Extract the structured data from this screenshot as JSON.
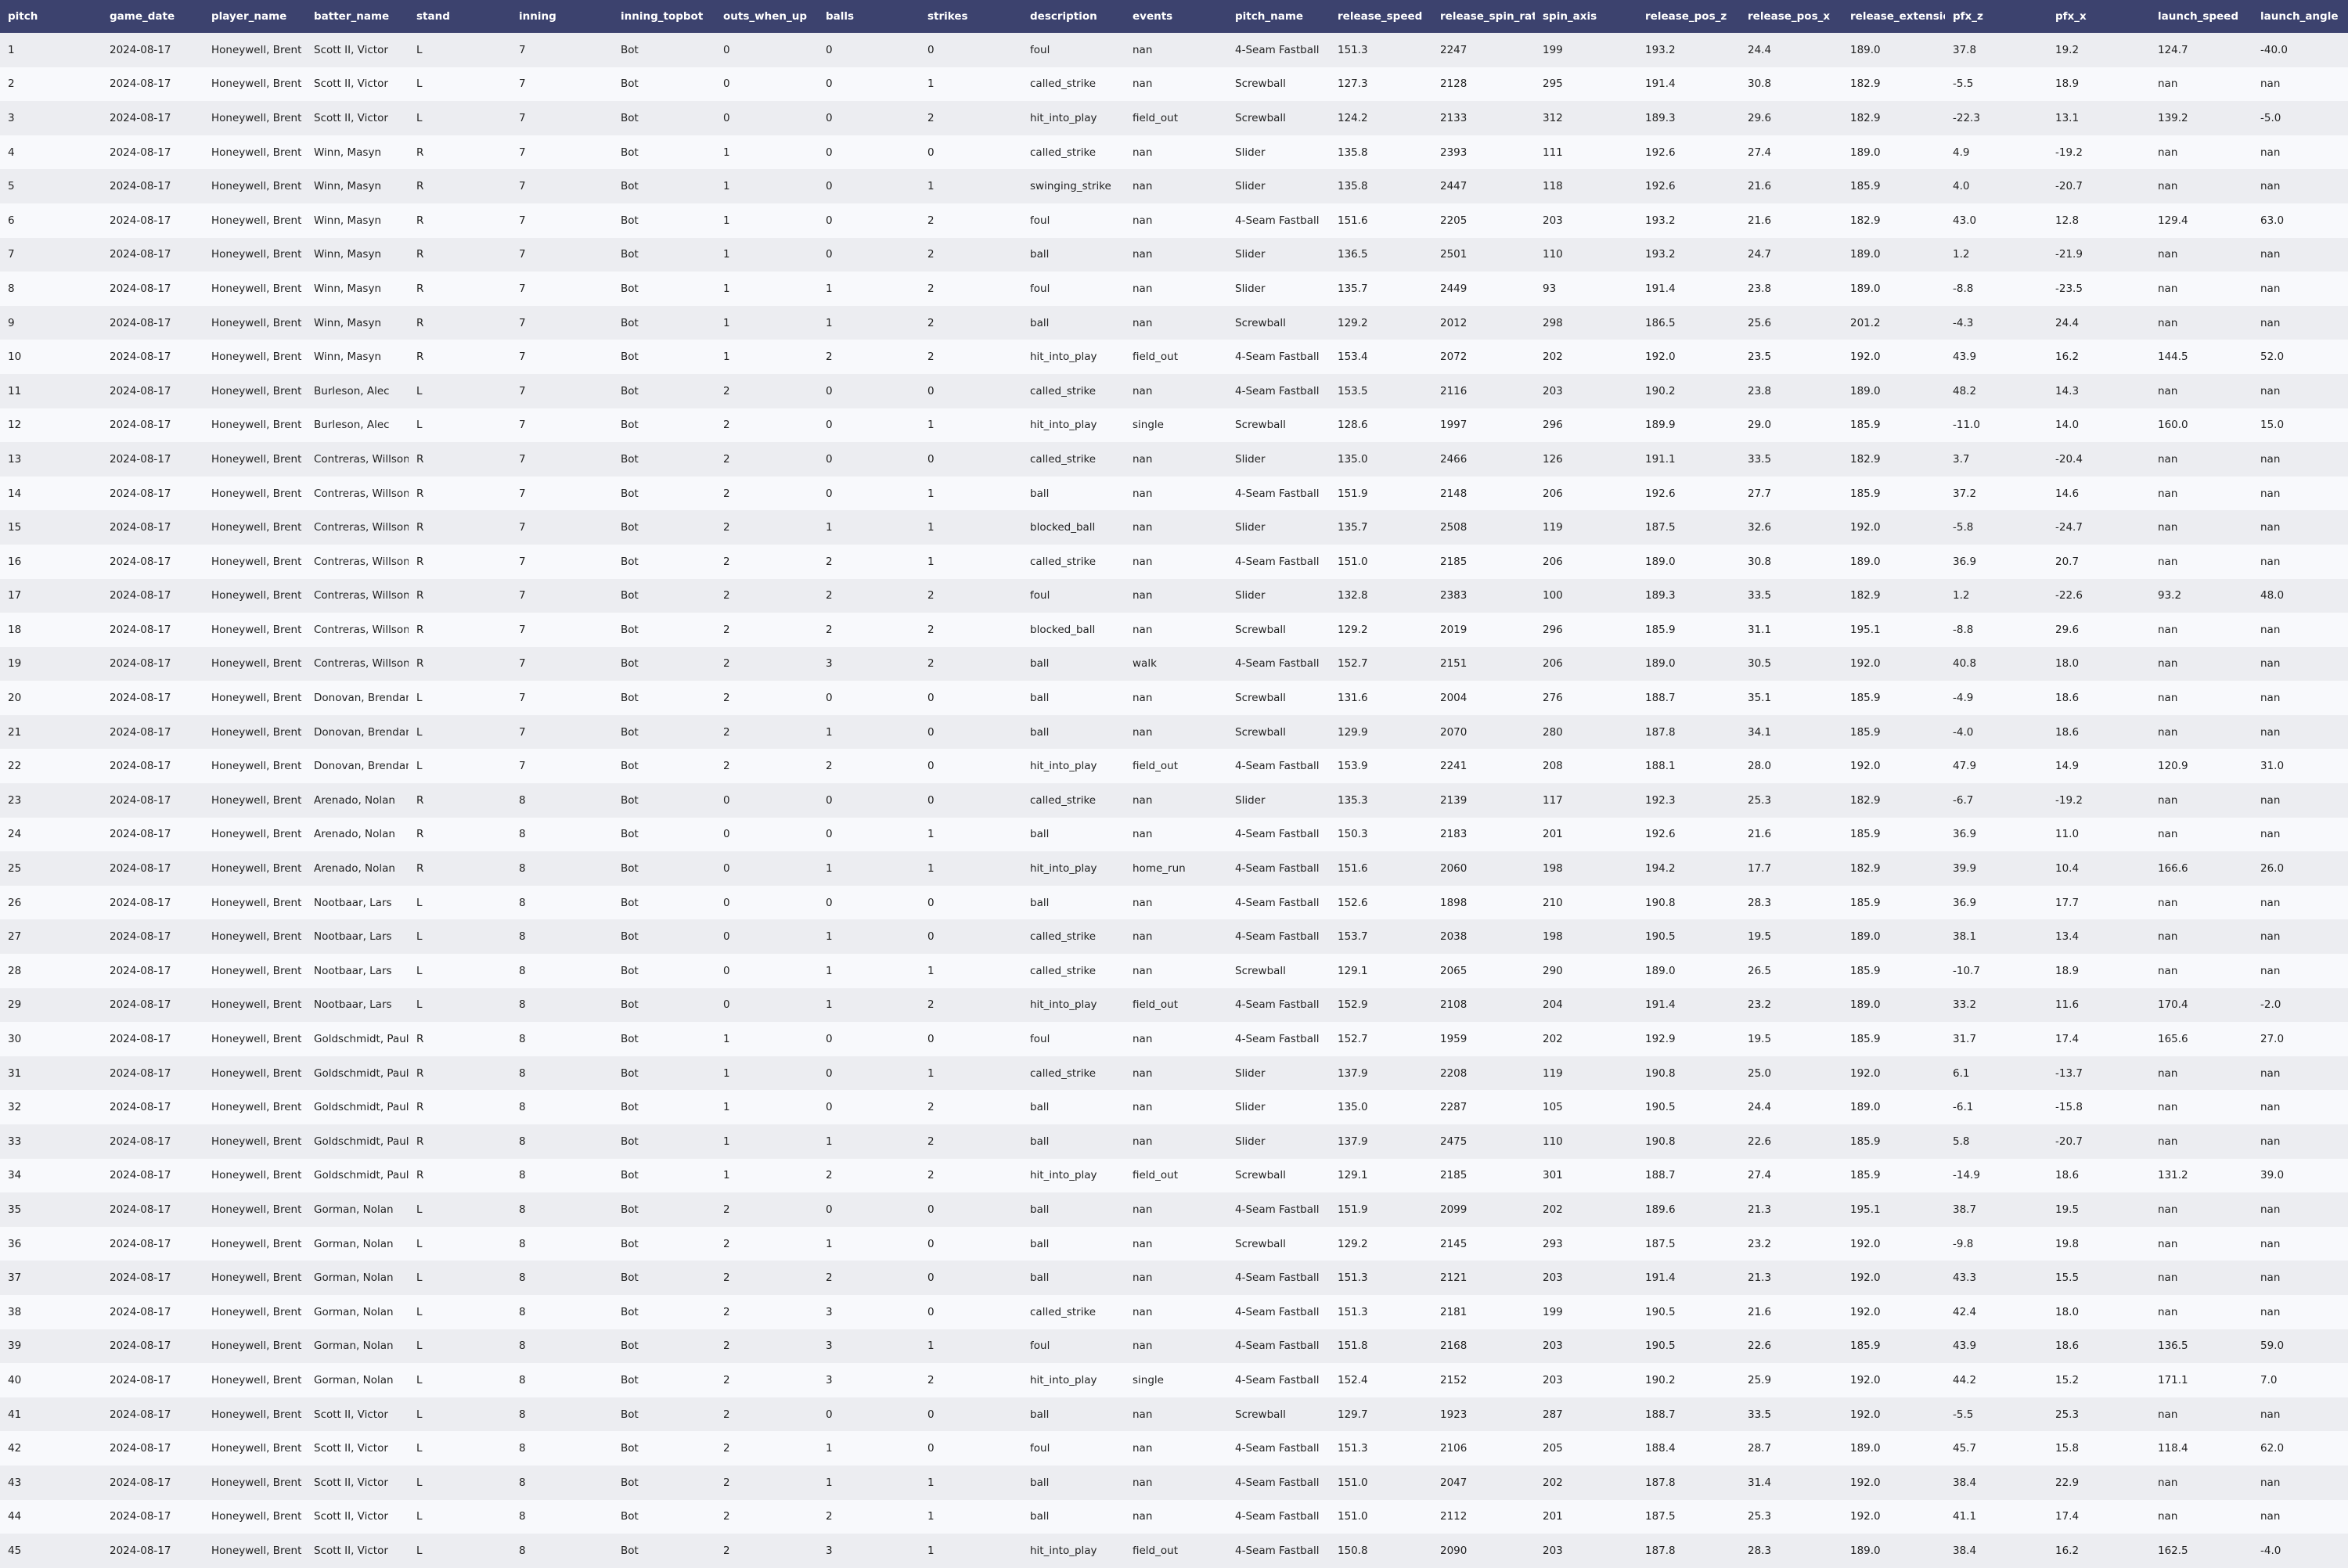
{
  "table": {
    "columns": [
      "pitch",
      "game_date",
      "player_name",
      "batter_name",
      "stand",
      "inning",
      "inning_topbot",
      "outs_when_up",
      "balls",
      "strikes",
      "description",
      "events",
      "pitch_name",
      "release_speed",
      "release_spin_rate",
      "spin_axis",
      "release_pos_z",
      "release_pos_x",
      "release_extension",
      "pfx_z",
      "pfx_x",
      "launch_speed",
      "launch_angle"
    ],
    "rows": [
      [
        "1",
        "2024-08-17",
        "Honeywell, Brent",
        "Scott II, Victor",
        "L",
        "7",
        "Bot",
        "0",
        "0",
        "0",
        "foul",
        "nan",
        "4-Seam Fastball",
        "151.3",
        "2247",
        "199",
        "193.2",
        "24.4",
        "189.0",
        "37.8",
        "19.2",
        "124.7",
        "-40.0"
      ],
      [
        "2",
        "2024-08-17",
        "Honeywell, Brent",
        "Scott II, Victor",
        "L",
        "7",
        "Bot",
        "0",
        "0",
        "1",
        "called_strike",
        "nan",
        "Screwball",
        "127.3",
        "2128",
        "295",
        "191.4",
        "30.8",
        "182.9",
        "-5.5",
        "18.9",
        "nan",
        "nan"
      ],
      [
        "3",
        "2024-08-17",
        "Honeywell, Brent",
        "Scott II, Victor",
        "L",
        "7",
        "Bot",
        "0",
        "0",
        "2",
        "hit_into_play",
        "field_out",
        "Screwball",
        "124.2",
        "2133",
        "312",
        "189.3",
        "29.6",
        "182.9",
        "-22.3",
        "13.1",
        "139.2",
        "-5.0"
      ],
      [
        "4",
        "2024-08-17",
        "Honeywell, Brent",
        "Winn, Masyn",
        "R",
        "7",
        "Bot",
        "1",
        "0",
        "0",
        "called_strike",
        "nan",
        "Slider",
        "135.8",
        "2393",
        "111",
        "192.6",
        "27.4",
        "189.0",
        "4.9",
        "-19.2",
        "nan",
        "nan"
      ],
      [
        "5",
        "2024-08-17",
        "Honeywell, Brent",
        "Winn, Masyn",
        "R",
        "7",
        "Bot",
        "1",
        "0",
        "1",
        "swinging_strike",
        "nan",
        "Slider",
        "135.8",
        "2447",
        "118",
        "192.6",
        "21.6",
        "185.9",
        "4.0",
        "-20.7",
        "nan",
        "nan"
      ],
      [
        "6",
        "2024-08-17",
        "Honeywell, Brent",
        "Winn, Masyn",
        "R",
        "7",
        "Bot",
        "1",
        "0",
        "2",
        "foul",
        "nan",
        "4-Seam Fastball",
        "151.6",
        "2205",
        "203",
        "193.2",
        "21.6",
        "182.9",
        "43.0",
        "12.8",
        "129.4",
        "63.0"
      ],
      [
        "7",
        "2024-08-17",
        "Honeywell, Brent",
        "Winn, Masyn",
        "R",
        "7",
        "Bot",
        "1",
        "0",
        "2",
        "ball",
        "nan",
        "Slider",
        "136.5",
        "2501",
        "110",
        "193.2",
        "24.7",
        "189.0",
        "1.2",
        "-21.9",
        "nan",
        "nan"
      ],
      [
        "8",
        "2024-08-17",
        "Honeywell, Brent",
        "Winn, Masyn",
        "R",
        "7",
        "Bot",
        "1",
        "1",
        "2",
        "foul",
        "nan",
        "Slider",
        "135.7",
        "2449",
        "93",
        "191.4",
        "23.8",
        "189.0",
        "-8.8",
        "-23.5",
        "nan",
        "nan"
      ],
      [
        "9",
        "2024-08-17",
        "Honeywell, Brent",
        "Winn, Masyn",
        "R",
        "7",
        "Bot",
        "1",
        "1",
        "2",
        "ball",
        "nan",
        "Screwball",
        "129.2",
        "2012",
        "298",
        "186.5",
        "25.6",
        "201.2",
        "-4.3",
        "24.4",
        "nan",
        "nan"
      ],
      [
        "10",
        "2024-08-17",
        "Honeywell, Brent",
        "Winn, Masyn",
        "R",
        "7",
        "Bot",
        "1",
        "2",
        "2",
        "hit_into_play",
        "field_out",
        "4-Seam Fastball",
        "153.4",
        "2072",
        "202",
        "192.0",
        "23.5",
        "192.0",
        "43.9",
        "16.2",
        "144.5",
        "52.0"
      ],
      [
        "11",
        "2024-08-17",
        "Honeywell, Brent",
        "Burleson, Alec",
        "L",
        "7",
        "Bot",
        "2",
        "0",
        "0",
        "called_strike",
        "nan",
        "4-Seam Fastball",
        "153.5",
        "2116",
        "203",
        "190.2",
        "23.8",
        "189.0",
        "48.2",
        "14.3",
        "nan",
        "nan"
      ],
      [
        "12",
        "2024-08-17",
        "Honeywell, Brent",
        "Burleson, Alec",
        "L",
        "7",
        "Bot",
        "2",
        "0",
        "1",
        "hit_into_play",
        "single",
        "Screwball",
        "128.6",
        "1997",
        "296",
        "189.9",
        "29.0",
        "185.9",
        "-11.0",
        "14.0",
        "160.0",
        "15.0"
      ],
      [
        "13",
        "2024-08-17",
        "Honeywell, Brent",
        "Contreras, Willson",
        "R",
        "7",
        "Bot",
        "2",
        "0",
        "0",
        "called_strike",
        "nan",
        "Slider",
        "135.0",
        "2466",
        "126",
        "191.1",
        "33.5",
        "182.9",
        "3.7",
        "-20.4",
        "nan",
        "nan"
      ],
      [
        "14",
        "2024-08-17",
        "Honeywell, Brent",
        "Contreras, Willson",
        "R",
        "7",
        "Bot",
        "2",
        "0",
        "1",
        "ball",
        "nan",
        "4-Seam Fastball",
        "151.9",
        "2148",
        "206",
        "192.6",
        "27.7",
        "185.9",
        "37.2",
        "14.6",
        "nan",
        "nan"
      ],
      [
        "15",
        "2024-08-17",
        "Honeywell, Brent",
        "Contreras, Willson",
        "R",
        "7",
        "Bot",
        "2",
        "1",
        "1",
        "blocked_ball",
        "nan",
        "Slider",
        "135.7",
        "2508",
        "119",
        "187.5",
        "32.6",
        "192.0",
        "-5.8",
        "-24.7",
        "nan",
        "nan"
      ],
      [
        "16",
        "2024-08-17",
        "Honeywell, Brent",
        "Contreras, Willson",
        "R",
        "7",
        "Bot",
        "2",
        "2",
        "1",
        "called_strike",
        "nan",
        "4-Seam Fastball",
        "151.0",
        "2185",
        "206",
        "189.0",
        "30.8",
        "189.0",
        "36.9",
        "20.7",
        "nan",
        "nan"
      ],
      [
        "17",
        "2024-08-17",
        "Honeywell, Brent",
        "Contreras, Willson",
        "R",
        "7",
        "Bot",
        "2",
        "2",
        "2",
        "foul",
        "nan",
        "Slider",
        "132.8",
        "2383",
        "100",
        "189.3",
        "33.5",
        "182.9",
        "1.2",
        "-22.6",
        "93.2",
        "48.0"
      ],
      [
        "18",
        "2024-08-17",
        "Honeywell, Brent",
        "Contreras, Willson",
        "R",
        "7",
        "Bot",
        "2",
        "2",
        "2",
        "blocked_ball",
        "nan",
        "Screwball",
        "129.2",
        "2019",
        "296",
        "185.9",
        "31.1",
        "195.1",
        "-8.8",
        "29.6",
        "nan",
        "nan"
      ],
      [
        "19",
        "2024-08-17",
        "Honeywell, Brent",
        "Contreras, Willson",
        "R",
        "7",
        "Bot",
        "2",
        "3",
        "2",
        "ball",
        "walk",
        "4-Seam Fastball",
        "152.7",
        "2151",
        "206",
        "189.0",
        "30.5",
        "192.0",
        "40.8",
        "18.0",
        "nan",
        "nan"
      ],
      [
        "20",
        "2024-08-17",
        "Honeywell, Brent",
        "Donovan, Brendan",
        "L",
        "7",
        "Bot",
        "2",
        "0",
        "0",
        "ball",
        "nan",
        "Screwball",
        "131.6",
        "2004",
        "276",
        "188.7",
        "35.1",
        "185.9",
        "-4.9",
        "18.6",
        "nan",
        "nan"
      ],
      [
        "21",
        "2024-08-17",
        "Honeywell, Brent",
        "Donovan, Brendan",
        "L",
        "7",
        "Bot",
        "2",
        "1",
        "0",
        "ball",
        "nan",
        "Screwball",
        "129.9",
        "2070",
        "280",
        "187.8",
        "34.1",
        "185.9",
        "-4.0",
        "18.6",
        "nan",
        "nan"
      ],
      [
        "22",
        "2024-08-17",
        "Honeywell, Brent",
        "Donovan, Brendan",
        "L",
        "7",
        "Bot",
        "2",
        "2",
        "0",
        "hit_into_play",
        "field_out",
        "4-Seam Fastball",
        "153.9",
        "2241",
        "208",
        "188.1",
        "28.0",
        "192.0",
        "47.9",
        "14.9",
        "120.9",
        "31.0"
      ],
      [
        "23",
        "2024-08-17",
        "Honeywell, Brent",
        "Arenado, Nolan",
        "R",
        "8",
        "Bot",
        "0",
        "0",
        "0",
        "called_strike",
        "nan",
        "Slider",
        "135.3",
        "2139",
        "117",
        "192.3",
        "25.3",
        "182.9",
        "-6.7",
        "-19.2",
        "nan",
        "nan"
      ],
      [
        "24",
        "2024-08-17",
        "Honeywell, Brent",
        "Arenado, Nolan",
        "R",
        "8",
        "Bot",
        "0",
        "0",
        "1",
        "ball",
        "nan",
        "4-Seam Fastball",
        "150.3",
        "2183",
        "201",
        "192.6",
        "21.6",
        "185.9",
        "36.9",
        "11.0",
        "nan",
        "nan"
      ],
      [
        "25",
        "2024-08-17",
        "Honeywell, Brent",
        "Arenado, Nolan",
        "R",
        "8",
        "Bot",
        "0",
        "1",
        "1",
        "hit_into_play",
        "home_run",
        "4-Seam Fastball",
        "151.6",
        "2060",
        "198",
        "194.2",
        "17.7",
        "182.9",
        "39.9",
        "10.4",
        "166.6",
        "26.0"
      ],
      [
        "26",
        "2024-08-17",
        "Honeywell, Brent",
        "Nootbaar, Lars",
        "L",
        "8",
        "Bot",
        "0",
        "0",
        "0",
        "ball",
        "nan",
        "4-Seam Fastball",
        "152.6",
        "1898",
        "210",
        "190.8",
        "28.3",
        "185.9",
        "36.9",
        "17.7",
        "nan",
        "nan"
      ],
      [
        "27",
        "2024-08-17",
        "Honeywell, Brent",
        "Nootbaar, Lars",
        "L",
        "8",
        "Bot",
        "0",
        "1",
        "0",
        "called_strike",
        "nan",
        "4-Seam Fastball",
        "153.7",
        "2038",
        "198",
        "190.5",
        "19.5",
        "189.0",
        "38.1",
        "13.4",
        "nan",
        "nan"
      ],
      [
        "28",
        "2024-08-17",
        "Honeywell, Brent",
        "Nootbaar, Lars",
        "L",
        "8",
        "Bot",
        "0",
        "1",
        "1",
        "called_strike",
        "nan",
        "Screwball",
        "129.1",
        "2065",
        "290",
        "189.0",
        "26.5",
        "185.9",
        "-10.7",
        "18.9",
        "nan",
        "nan"
      ],
      [
        "29",
        "2024-08-17",
        "Honeywell, Brent",
        "Nootbaar, Lars",
        "L",
        "8",
        "Bot",
        "0",
        "1",
        "2",
        "hit_into_play",
        "field_out",
        "4-Seam Fastball",
        "152.9",
        "2108",
        "204",
        "191.4",
        "23.2",
        "189.0",
        "33.2",
        "11.6",
        "170.4",
        "-2.0"
      ],
      [
        "30",
        "2024-08-17",
        "Honeywell, Brent",
        "Goldschmidt, Paul",
        "R",
        "8",
        "Bot",
        "1",
        "0",
        "0",
        "foul",
        "nan",
        "4-Seam Fastball",
        "152.7",
        "1959",
        "202",
        "192.9",
        "19.5",
        "185.9",
        "31.7",
        "17.4",
        "165.6",
        "27.0"
      ],
      [
        "31",
        "2024-08-17",
        "Honeywell, Brent",
        "Goldschmidt, Paul",
        "R",
        "8",
        "Bot",
        "1",
        "0",
        "1",
        "called_strike",
        "nan",
        "Slider",
        "137.9",
        "2208",
        "119",
        "190.8",
        "25.0",
        "192.0",
        "6.1",
        "-13.7",
        "nan",
        "nan"
      ],
      [
        "32",
        "2024-08-17",
        "Honeywell, Brent",
        "Goldschmidt, Paul",
        "R",
        "8",
        "Bot",
        "1",
        "0",
        "2",
        "ball",
        "nan",
        "Slider",
        "135.0",
        "2287",
        "105",
        "190.5",
        "24.4",
        "189.0",
        "-6.1",
        "-15.8",
        "nan",
        "nan"
      ],
      [
        "33",
        "2024-08-17",
        "Honeywell, Brent",
        "Goldschmidt, Paul",
        "R",
        "8",
        "Bot",
        "1",
        "1",
        "2",
        "ball",
        "nan",
        "Slider",
        "137.9",
        "2475",
        "110",
        "190.8",
        "22.6",
        "185.9",
        "5.8",
        "-20.7",
        "nan",
        "nan"
      ],
      [
        "34",
        "2024-08-17",
        "Honeywell, Brent",
        "Goldschmidt, Paul",
        "R",
        "8",
        "Bot",
        "1",
        "2",
        "2",
        "hit_into_play",
        "field_out",
        "Screwball",
        "129.1",
        "2185",
        "301",
        "188.7",
        "27.4",
        "185.9",
        "-14.9",
        "18.6",
        "131.2",
        "39.0"
      ],
      [
        "35",
        "2024-08-17",
        "Honeywell, Brent",
        "Gorman, Nolan",
        "L",
        "8",
        "Bot",
        "2",
        "0",
        "0",
        "ball",
        "nan",
        "4-Seam Fastball",
        "151.9",
        "2099",
        "202",
        "189.6",
        "21.3",
        "195.1",
        "38.7",
        "19.5",
        "nan",
        "nan"
      ],
      [
        "36",
        "2024-08-17",
        "Honeywell, Brent",
        "Gorman, Nolan",
        "L",
        "8",
        "Bot",
        "2",
        "1",
        "0",
        "ball",
        "nan",
        "Screwball",
        "129.2",
        "2145",
        "293",
        "187.5",
        "23.2",
        "192.0",
        "-9.8",
        "19.8",
        "nan",
        "nan"
      ],
      [
        "37",
        "2024-08-17",
        "Honeywell, Brent",
        "Gorman, Nolan",
        "L",
        "8",
        "Bot",
        "2",
        "2",
        "0",
        "ball",
        "nan",
        "4-Seam Fastball",
        "151.3",
        "2121",
        "203",
        "191.4",
        "21.3",
        "192.0",
        "43.3",
        "15.5",
        "nan",
        "nan"
      ],
      [
        "38",
        "2024-08-17",
        "Honeywell, Brent",
        "Gorman, Nolan",
        "L",
        "8",
        "Bot",
        "2",
        "3",
        "0",
        "called_strike",
        "nan",
        "4-Seam Fastball",
        "151.3",
        "2181",
        "199",
        "190.5",
        "21.6",
        "192.0",
        "42.4",
        "18.0",
        "nan",
        "nan"
      ],
      [
        "39",
        "2024-08-17",
        "Honeywell, Brent",
        "Gorman, Nolan",
        "L",
        "8",
        "Bot",
        "2",
        "3",
        "1",
        "foul",
        "nan",
        "4-Seam Fastball",
        "151.8",
        "2168",
        "203",
        "190.5",
        "22.6",
        "185.9",
        "43.9",
        "18.6",
        "136.5",
        "59.0"
      ],
      [
        "40",
        "2024-08-17",
        "Honeywell, Brent",
        "Gorman, Nolan",
        "L",
        "8",
        "Bot",
        "2",
        "3",
        "2",
        "hit_into_play",
        "single",
        "4-Seam Fastball",
        "152.4",
        "2152",
        "203",
        "190.2",
        "25.9",
        "192.0",
        "44.2",
        "15.2",
        "171.1",
        "7.0"
      ],
      [
        "41",
        "2024-08-17",
        "Honeywell, Brent",
        "Scott II, Victor",
        "L",
        "8",
        "Bot",
        "2",
        "0",
        "0",
        "ball",
        "nan",
        "Screwball",
        "129.7",
        "1923",
        "287",
        "188.7",
        "33.5",
        "192.0",
        "-5.5",
        "25.3",
        "nan",
        "nan"
      ],
      [
        "42",
        "2024-08-17",
        "Honeywell, Brent",
        "Scott II, Victor",
        "L",
        "8",
        "Bot",
        "2",
        "1",
        "0",
        "foul",
        "nan",
        "4-Seam Fastball",
        "151.3",
        "2106",
        "205",
        "188.4",
        "28.7",
        "189.0",
        "45.7",
        "15.8",
        "118.4",
        "62.0"
      ],
      [
        "43",
        "2024-08-17",
        "Honeywell, Brent",
        "Scott II, Victor",
        "L",
        "8",
        "Bot",
        "2",
        "1",
        "1",
        "ball",
        "nan",
        "4-Seam Fastball",
        "151.0",
        "2047",
        "202",
        "187.8",
        "31.4",
        "192.0",
        "38.4",
        "22.9",
        "nan",
        "nan"
      ],
      [
        "44",
        "2024-08-17",
        "Honeywell, Brent",
        "Scott II, Victor",
        "L",
        "8",
        "Bot",
        "2",
        "2",
        "1",
        "ball",
        "nan",
        "4-Seam Fastball",
        "151.0",
        "2112",
        "201",
        "187.5",
        "25.3",
        "192.0",
        "41.1",
        "17.4",
        "nan",
        "nan"
      ],
      [
        "45",
        "2024-08-17",
        "Honeywell, Brent",
        "Scott II, Victor",
        "L",
        "8",
        "Bot",
        "2",
        "3",
        "1",
        "hit_into_play",
        "field_out",
        "4-Seam Fastball",
        "150.8",
        "2090",
        "203",
        "187.8",
        "28.3",
        "189.0",
        "38.4",
        "16.2",
        "162.5",
        "-4.0"
      ]
    ]
  },
  "colors": {
    "header_bg": "#3c426e",
    "header_text": "#ffffff",
    "row_odd": "#ecedf1",
    "row_even": "#f8f9fc"
  }
}
